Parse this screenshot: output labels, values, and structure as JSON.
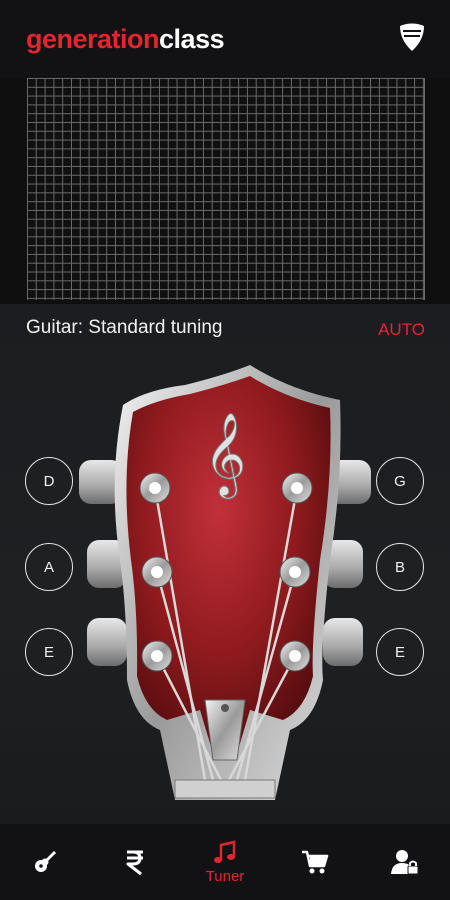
{
  "header": {
    "logo_part1": "generation",
    "logo_part2": "class",
    "shield_icon": "guitar-pick-shield-icon"
  },
  "tuner": {
    "instrument_label": "Guitar: Standard tuning",
    "mode_label": "AUTO",
    "strings_left": [
      "D",
      "A",
      "E"
    ],
    "strings_right": [
      "G",
      "B",
      "E"
    ]
  },
  "nav": {
    "items": [
      {
        "icon": "guitar-icon",
        "label": ""
      },
      {
        "icon": "rupee-icon",
        "label": ""
      },
      {
        "icon": "music-note-icon",
        "label": "Tuner",
        "active": true
      },
      {
        "icon": "cart-icon",
        "label": ""
      },
      {
        "icon": "user-lock-icon",
        "label": ""
      }
    ]
  },
  "colors": {
    "accent": "#e3262e",
    "background": "#141416",
    "headstock_red": "#8e1a1e"
  }
}
